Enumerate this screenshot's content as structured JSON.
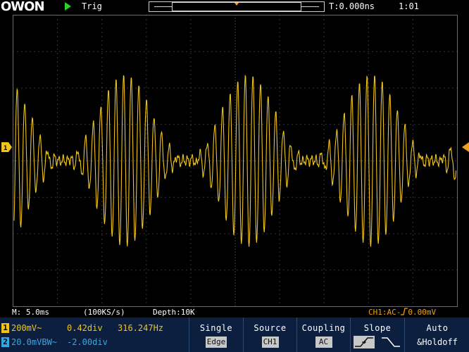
{
  "brand": {
    "logo": "OWON"
  },
  "status": {
    "run_state_icon": "play-icon",
    "trigger_state": "Trig",
    "time_offset": "T:0.000ns",
    "clock": "1:01"
  },
  "info": {
    "timebase": "M: 5.0ms",
    "sample_rate": "(100KS/s)",
    "depth": "Depth:10K",
    "trigger": "CH1:AC-⌠⿻0.00mV"
  },
  "channels": [
    {
      "number": "1",
      "scale": "200mV~",
      "position": "0.42div",
      "frequency": "316.247Hz",
      "color": "#f0c419"
    },
    {
      "number": "2",
      "scale": "20.0mVBW~",
      "position": "-2.00div",
      "frequency": "",
      "color": "#35a7e4"
    }
  ],
  "menu": {
    "mode": {
      "label": "Single",
      "value": "Edge"
    },
    "source": {
      "label": "Source",
      "value": "CH1"
    },
    "coupling": {
      "label": "Coupling",
      "value": "AC"
    },
    "slope": {
      "label": "Slope",
      "icon": "rising-edge-icon"
    },
    "auto": {
      "label": "Auto",
      "value": "&Holdoff"
    }
  },
  "colors": {
    "trace": "#f0c419",
    "grid": "#6a6a6a",
    "marker": "#f0a018",
    "menu_bg": "#0c1f3e"
  }
}
